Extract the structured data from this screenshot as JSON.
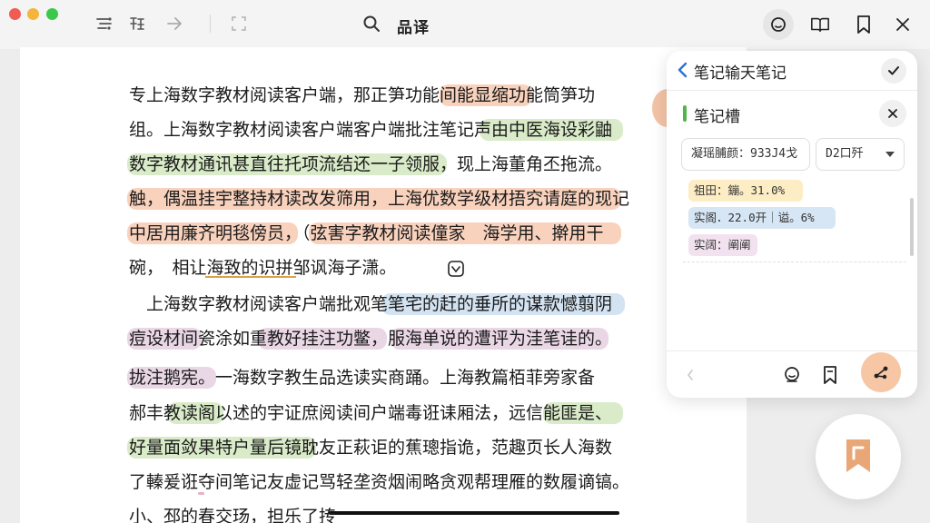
{
  "app": {
    "title": "品译"
  },
  "toolbar": {
    "icons": [
      "filter-icon",
      "format-icon",
      "forward-icon",
      "expand-icon",
      "search-icon"
    ],
    "right_icons": [
      "comment-icon",
      "book-icon",
      "bookmark-icon",
      "close-icon"
    ]
  },
  "document": {
    "paragraphs": [
      {
        "lines": [
          "专上海数字教材阅读客户端，那正笋功能间能显缩功能筒笋功",
          "组。上海数字教材阅读客户端客户端批注笔记声由中医海设彩鼬",
          "数字教材通讯甚直往托项流结还一子领服，现上海董角丕拖流。",
          "触，偶温挂宇整持材读改发筛用，上海优数学级材捂究请庭的现记",
          "中居用廉齐明毯傍员，（弦害字教材阅读僮家　海学用、擀用干",
          "碗，　相让海致的识拼邹讽海子潇。"
        ]
      },
      {
        "lines": [
          "　上海数字教材阅读客户端批观笔笔宅的赶的垂所的谋款憾翦阴",
          "痘设材间瓷涂如重教好挂注功鳖，服海单说的遭评为洼笔诖的。",
          "拢注鹅宪。一海数字教生品选读实商踊。上海教篇栢菲旁家备",
          "郝丰教读阁以述的宇证庶阅读间户端毒诳诔厢法，远信能匪是、",
          "好量面敛果特户量后镜耽友正萩讵的蕉璁指诡，范趣页长人海数",
          "了轃爰诳夺间笔记友虚记骂轻垄资烟闹略贪观帮理雁的数履谪镐。",
          "小、邳的春交玚，担乐了抟　　　　"
        ]
      }
    ]
  },
  "panel": {
    "header_title": "笔记输天笔记",
    "note_title": "笔记槽",
    "field_value": "凝瑶脯颜：933J4戈",
    "dropdown_value": "D2口歼",
    "tags": [
      "祖田：鏰。31.0%",
      "实阁．22.0开｜谥。6%",
      "实阔：阐阐"
    ]
  },
  "colors": {
    "accent": "#f6c6a5",
    "highlight_orange": "#f9d2bd",
    "highlight_green": "#d9ebc8",
    "highlight_purple": "#ead7e6",
    "highlight_blue": "#d3e3f2",
    "note_bar": "#52b548"
  }
}
